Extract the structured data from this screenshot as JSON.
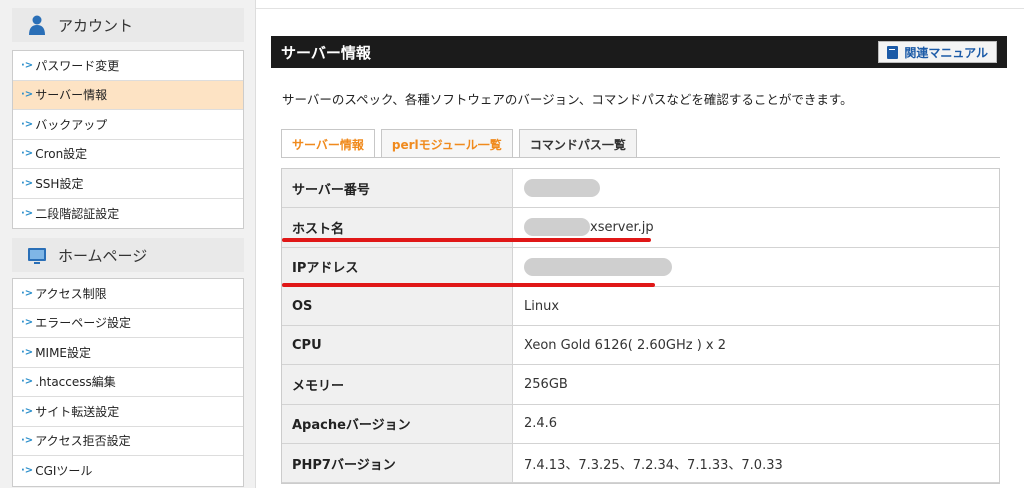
{
  "sidebar": {
    "account_header": "アカウント",
    "account_items": [
      {
        "label": "パスワード変更",
        "active": false
      },
      {
        "label": "サーバー情報",
        "active": true
      },
      {
        "label": "バックアップ",
        "active": false
      },
      {
        "label": "Cron設定",
        "active": false
      },
      {
        "label": "SSH設定",
        "active": false
      },
      {
        "label": "二段階認証設定",
        "active": false
      }
    ],
    "homepage_header": "ホームページ",
    "homepage_items": [
      {
        "label": "アクセス制限"
      },
      {
        "label": "エラーページ設定"
      },
      {
        "label": "MIME設定"
      },
      {
        "label": ".htaccess編集"
      },
      {
        "label": "サイト転送設定"
      },
      {
        "label": "アクセス拒否設定"
      },
      {
        "label": "CGIツール"
      }
    ],
    "arrow_glyph": "·>"
  },
  "main": {
    "title": "サーバー情報",
    "manual_button": "関連マニュアル",
    "description": "サーバーのスペック、各種ソフトウェアのバージョン、コマンドパスなどを確認することができます。",
    "tabs": [
      {
        "label": "サーバー情報",
        "active": true
      },
      {
        "label": "perlモジュール一覧",
        "active": false
      },
      {
        "label": "コマンドパス一覧",
        "active": false
      }
    ],
    "rows": [
      {
        "key": "サーバー番号",
        "value": "",
        "masked": true
      },
      {
        "key": "ホスト名",
        "value": "xserver.jp",
        "masked": true
      },
      {
        "key": "IPアドレス",
        "value": "",
        "masked": true
      },
      {
        "key": "OS",
        "value": "Linux",
        "masked": false
      },
      {
        "key": "CPU",
        "value": "Xeon Gold 6126( 2.60GHz ) x 2",
        "masked": false
      },
      {
        "key": "メモリー",
        "value": "256GB",
        "masked": false
      },
      {
        "key": "Apacheバージョン",
        "value": "2.4.6",
        "masked": false
      },
      {
        "key": "PHP7バージョン",
        "value": "7.4.13、7.3.25、7.2.34、7.1.33、7.0.33",
        "masked": false
      }
    ]
  },
  "colors": {
    "accent_orange": "#f08a1d",
    "title_bar": "#1b1b1b",
    "active_sidebar": "#fde3c4",
    "annotation_red": "#e01717",
    "link_blue": "#1b5aa7"
  }
}
